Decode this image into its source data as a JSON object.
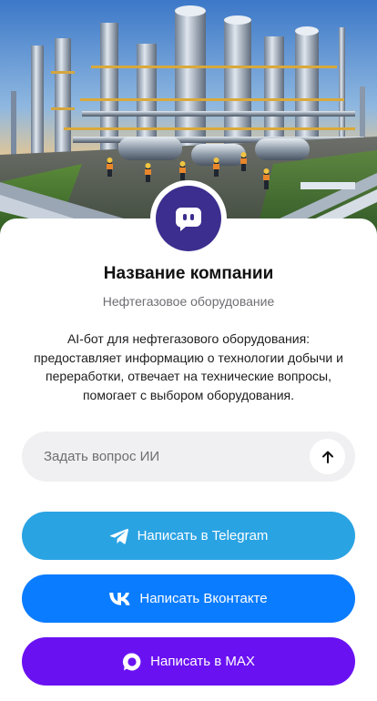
{
  "company": {
    "name": "Название компании",
    "subtitle": "Нефтегазовое оборудование",
    "description": "AI-бот для нефтегазового оборудования: предоставляет информацию о технологии добычи и переработки, отвечает на технические вопросы, помогает с выбором оборудования."
  },
  "ask": {
    "placeholder": "Задать вопрос ИИ",
    "value": "",
    "send_icon": "arrow-up-icon"
  },
  "buttons": {
    "telegram": {
      "label": "Написать в Telegram",
      "icon": "telegram-icon",
      "color": "#2aa3e3"
    },
    "vk": {
      "label": "Написать Вконтакте",
      "icon": "vk-icon",
      "color": "#0a7cff"
    },
    "max": {
      "label": "Написать в MAX",
      "icon": "max-icon",
      "color": "#6a11f2"
    }
  },
  "avatar": {
    "icon": "chat-bot-icon",
    "color": "#3b2e8e"
  }
}
